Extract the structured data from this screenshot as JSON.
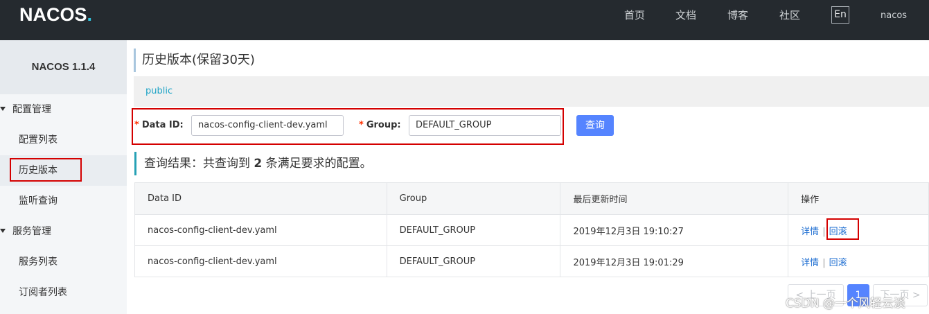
{
  "header": {
    "logo": "NACOS",
    "logo_dot": ".",
    "nav": [
      "首页",
      "文档",
      "博客",
      "社区"
    ],
    "lang": "En",
    "user": "nacos"
  },
  "sidebar": {
    "title": "NACOS 1.1.4",
    "groups": [
      {
        "label": "配置管理",
        "items": [
          "配置列表",
          "历史版本",
          "监听查询"
        ]
      },
      {
        "label": "服务管理",
        "items": [
          "服务列表",
          "订阅者列表"
        ]
      }
    ],
    "active_item": "历史版本"
  },
  "main": {
    "title": "历史版本(保留30天)",
    "namespace": "public",
    "form": {
      "data_id_label": "Data ID:",
      "data_id_value": "nacos-config-client-dev.yaml",
      "group_label": "Group:",
      "group_value": "DEFAULT_GROUP",
      "required_mark": "*",
      "query_button": "查询"
    },
    "result": {
      "prefix": "查询结果：共查询到",
      "count": "2",
      "suffix": "条满足要求的配置。"
    },
    "table": {
      "headers": [
        "Data ID",
        "Group",
        "最后更新时间",
        "操作"
      ],
      "rows": [
        {
          "data_id": "nacos-config-client-dev.yaml",
          "group": "DEFAULT_GROUP",
          "updated": "2019年12月3日 19:10:27",
          "detail": "详情",
          "rollback": "回滚"
        },
        {
          "data_id": "nacos-config-client-dev.yaml",
          "group": "DEFAULT_GROUP",
          "updated": "2019年12月3日 19:01:29",
          "detail": "详情",
          "rollback": "回滚"
        }
      ],
      "separator": "|"
    },
    "pager": {
      "prev": "< 上一页",
      "current": "1",
      "next": "下一页 >"
    }
  },
  "watermark": "CSDN @一个风轻云淡",
  "colors": {
    "topbar": "#252a2f",
    "primary": "#5584ff",
    "link": "#1f6fd2",
    "highlight": "#d40000"
  }
}
